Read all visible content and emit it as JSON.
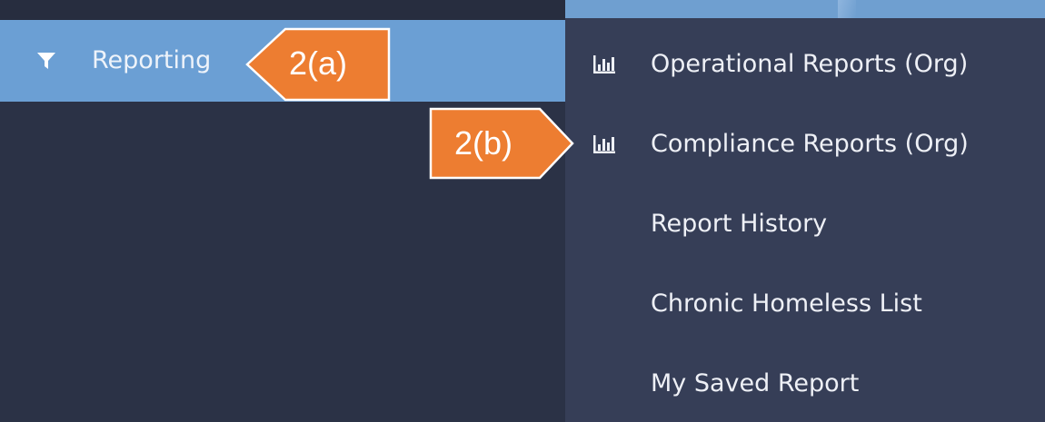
{
  "sidebar": {
    "reporting": {
      "label": "Reporting",
      "icon": "filter-icon"
    }
  },
  "submenu": {
    "items": [
      {
        "label": "Operational Reports (Org)",
        "icon": "bar-chart-icon"
      },
      {
        "label": "Compliance Reports (Org)",
        "icon": "bar-chart-icon"
      },
      {
        "label": "Report History",
        "icon": null
      },
      {
        "label": "Chronic Homeless List",
        "icon": null
      },
      {
        "label": "My Saved Report",
        "icon": null
      }
    ]
  },
  "callouts": {
    "a": "2(a)",
    "b": "2(b)"
  },
  "colors": {
    "sidebar_bg": "#2b3246",
    "active_item_bg": "#6b9fd4",
    "submenu_bg": "#363e57",
    "callout_fill": "#ed7d31",
    "callout_border": "#ffffff",
    "text": "#eef0f6"
  }
}
